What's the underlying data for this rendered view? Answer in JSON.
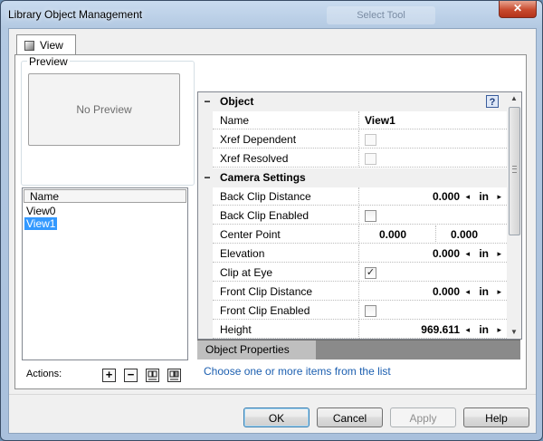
{
  "window": {
    "title": "Library Object Management",
    "background_title": "Select Tool",
    "close_glyph": "✕"
  },
  "tab": {
    "label": "View"
  },
  "preview": {
    "legend": "Preview",
    "placeholder": "No Preview"
  },
  "names_list": {
    "header": "Name",
    "items": [
      {
        "label": "View0",
        "selected": false
      },
      {
        "label": "View1",
        "selected": true
      }
    ]
  },
  "actions": {
    "label": "Actions:",
    "buttons": [
      {
        "icon": "add-icon",
        "glyph": "+"
      },
      {
        "icon": "remove-icon",
        "glyph": "−"
      },
      {
        "icon": "import-icon",
        "glyph": ""
      },
      {
        "icon": "export-icon",
        "glyph": ""
      }
    ]
  },
  "properties": {
    "categories": [
      {
        "toggle": "−",
        "label": "Object",
        "help": "?"
      },
      {
        "toggle": "−",
        "label": "Camera Settings"
      }
    ],
    "rows": [
      {
        "label": "Name",
        "value": "View1"
      },
      {
        "label": "Xref Dependent",
        "checked": false
      },
      {
        "label": "Xref Resolved",
        "checked": false
      },
      {
        "label": "Back Clip Distance",
        "value": "0.000",
        "unit": "in"
      },
      {
        "label": "Back Clip Enabled",
        "checked": false
      },
      {
        "label": "Center Point",
        "value_x": "0.000",
        "value_y": "0.000"
      },
      {
        "label": "Elevation",
        "value": "0.000",
        "unit": "in"
      },
      {
        "label": "Clip at Eye",
        "checked": true
      },
      {
        "label": "Front Clip Distance",
        "value": "0.000",
        "unit": "in"
      },
      {
        "label": "Front Clip Enabled",
        "checked": false
      },
      {
        "label": "Height",
        "value": "969.611",
        "unit": "in"
      }
    ],
    "spin_left": "◂",
    "spin_right": "▸",
    "check_glyph": "✓",
    "scroll_up": "▲",
    "scroll_down": "▼"
  },
  "description": {
    "title": "Object Properties",
    "text": "Choose one or more items from the list"
  },
  "buttons": {
    "ok": "OK",
    "cancel": "Cancel",
    "apply": "Apply",
    "help": "Help"
  }
}
